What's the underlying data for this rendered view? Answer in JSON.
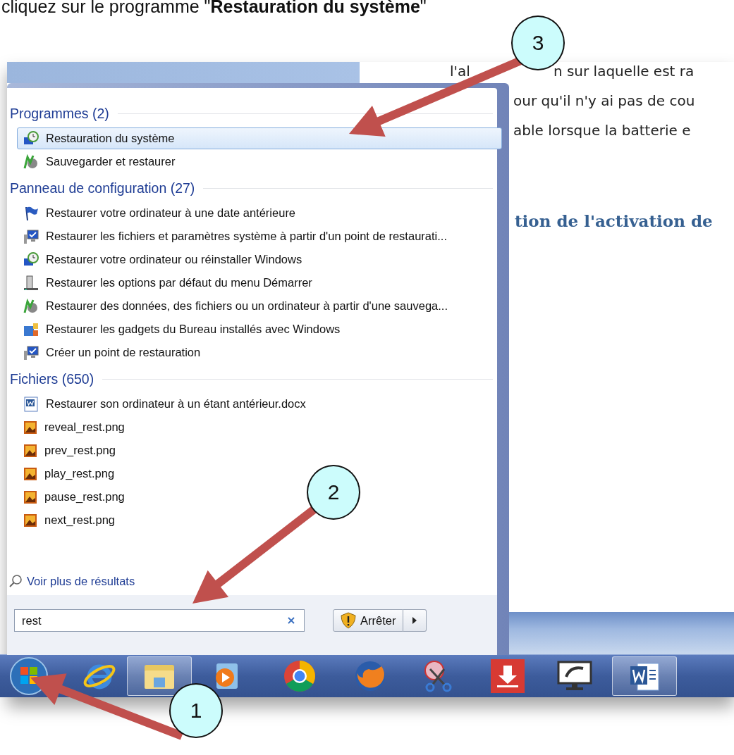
{
  "instruction": {
    "text": "cliquez sur le programme \"**Restauration du système**\""
  },
  "document": {
    "lines": [
      [
        "l'al",
        "n  sur laquelle est ra"
      ],
      [
        "our qu'il n'y ai pas de cou"
      ],
      [
        "able lorsque la batterie e"
      ]
    ],
    "heading": "tion de l'activation de "
  },
  "start_menu": {
    "groups": [
      {
        "title": "Programmes (2)",
        "items": [
          {
            "label": "Restauration du système",
            "kind": "system-restore",
            "selected": true
          },
          {
            "label": "Sauvegarder et restaurer",
            "kind": "backup",
            "selected": false
          }
        ]
      },
      {
        "title": "Panneau de configuration (27)",
        "items": [
          {
            "label": "Restaurer votre ordinateur à une date antérieure",
            "kind": "flag",
            "selected": false
          },
          {
            "label": "Restaurer les fichiers et paramètres système à partir d'un point de restaurati...",
            "kind": "monitor",
            "selected": false
          },
          {
            "label": "Restaurer votre ordinateur ou réinstaller Windows",
            "kind": "system-restore",
            "selected": false
          },
          {
            "label": "Restaurer les options par défaut du menu Démarrer",
            "kind": "tower",
            "selected": false
          },
          {
            "label": "Restaurer des données, des fichiers ou un ordinateur à partir d'une sauvega...",
            "kind": "backup",
            "selected": false
          },
          {
            "label": "Restaurer les gadgets du Bureau installés avec Windows",
            "kind": "gadgets",
            "selected": false
          },
          {
            "label": "Créer un point de restauration",
            "kind": "monitor",
            "selected": false
          }
        ]
      },
      {
        "title": "Fichiers (650)",
        "items": [
          {
            "label": "Restaurer son ordinateur à un étant antérieur.docx",
            "kind": "word-doc",
            "selected": false
          },
          {
            "label": "reveal_rest.png",
            "kind": "image",
            "selected": false
          },
          {
            "label": "prev_rest.png",
            "kind": "image",
            "selected": false
          },
          {
            "label": "play_rest.png",
            "kind": "image",
            "selected": false
          },
          {
            "label": "pause_rest.png",
            "kind": "image",
            "selected": false
          },
          {
            "label": "next_rest.png",
            "kind": "image",
            "selected": false
          }
        ]
      }
    ],
    "more_results": "Voir plus de résultats",
    "search": {
      "value": "rest"
    },
    "shutdown_button": "Arrêter"
  },
  "taskbar": {
    "items": [
      {
        "kind": "start",
        "active": false
      },
      {
        "kind": "ie",
        "active": false
      },
      {
        "kind": "explorer",
        "active": true
      },
      {
        "kind": "media",
        "active": false
      },
      {
        "kind": "chrome",
        "active": false
      },
      {
        "kind": "firefox",
        "active": false
      },
      {
        "kind": "snipping",
        "active": false
      },
      {
        "kind": "download",
        "active": false
      },
      {
        "kind": "sg",
        "active": false
      },
      {
        "kind": "word",
        "active": true
      }
    ]
  },
  "callouts": [
    {
      "number": "3"
    },
    {
      "number": "2"
    },
    {
      "number": "1"
    }
  ]
}
